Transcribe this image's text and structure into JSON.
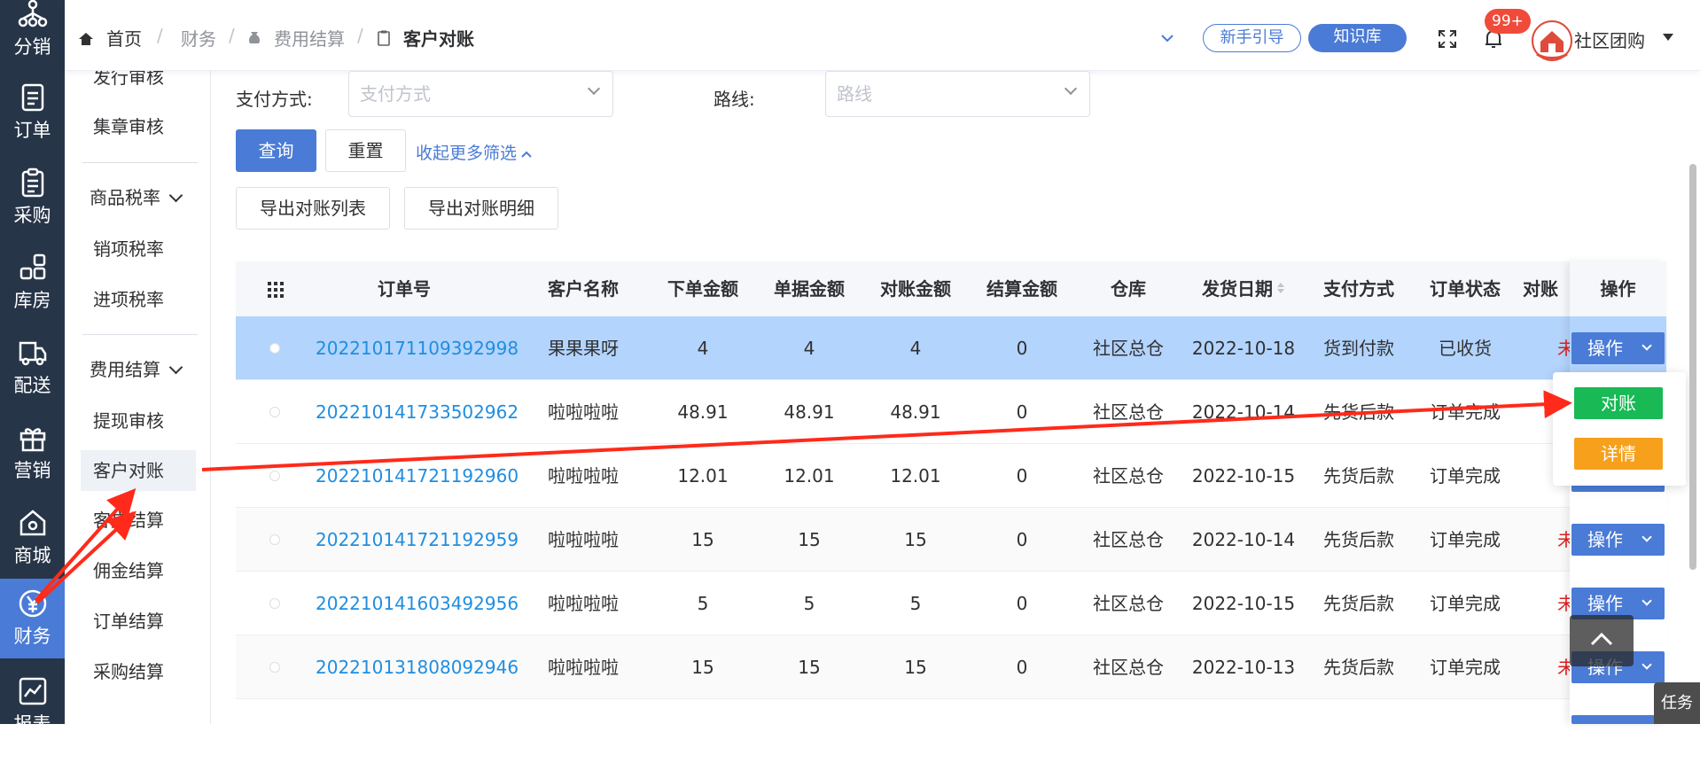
{
  "rail": {
    "items": [
      {
        "label": "分销",
        "icon": "sitemap-icon"
      },
      {
        "label": "订单",
        "icon": "document-icon"
      },
      {
        "label": "采购",
        "icon": "clipboard-icon"
      },
      {
        "label": "库房",
        "icon": "grid-icon"
      },
      {
        "label": "配送",
        "icon": "truck-icon"
      },
      {
        "label": "营销",
        "icon": "gift-icon"
      },
      {
        "label": "商城",
        "icon": "store-icon"
      },
      {
        "label": "财务",
        "icon": "yen-icon"
      },
      {
        "label": "报表",
        "icon": "chart-icon"
      }
    ]
  },
  "subnav": {
    "items": [
      "发行审核",
      "集章审核",
      "商品税率",
      "销项税率",
      "进项税率",
      "费用结算",
      "提现审核",
      "客户对账",
      "客户结算",
      "佣金结算",
      "订单结算",
      "采购结算"
    ]
  },
  "header": {
    "home": "首页",
    "crumb1": "财务",
    "crumb2": "费用结算",
    "crumb3": "客户对账",
    "guide": "新手引导",
    "kb": "知识库",
    "badge": "99+",
    "user": "社区团购"
  },
  "filters": {
    "pay_label": "支付方式:",
    "pay_placeholder": "支付方式",
    "route_label": "路线:",
    "route_placeholder": "路线",
    "query": "查询",
    "reset": "重置",
    "collapse": "收起更多筛选",
    "export_list": "导出对账列表",
    "export_detail": "导出对账明细"
  },
  "table": {
    "headers": [
      "订单号",
      "客户名称",
      "下单金额",
      "单据金额",
      "对账金额",
      "结算金额",
      "仓库",
      "发货日期",
      "支付方式",
      "订单状态",
      "对账",
      "操作"
    ],
    "op_label": "操作",
    "rows": [
      {
        "order": "202210171109392998",
        "customer": "果果果呀",
        "order_amt": "4",
        "doc_amt": "4",
        "rec_amt": "4",
        "settle_amt": "0",
        "wh": "社区总仓",
        "date": "2022-10-18",
        "pay": "货到付款",
        "status": "已收货",
        "rec": "未"
      },
      {
        "order": "202210141733502962",
        "customer": "啦啦啦啦",
        "order_amt": "48.91",
        "doc_amt": "48.91",
        "rec_amt": "48.91",
        "settle_amt": "0",
        "wh": "社区总仓",
        "date": "2022-10-14",
        "pay": "先货后款",
        "status": "订单完成",
        "rec": ""
      },
      {
        "order": "202210141721192960",
        "customer": "啦啦啦啦",
        "order_amt": "12.01",
        "doc_amt": "12.01",
        "rec_amt": "12.01",
        "settle_amt": "0",
        "wh": "社区总仓",
        "date": "2022-10-15",
        "pay": "先货后款",
        "status": "订单完成",
        "rec": ""
      },
      {
        "order": "202210141721192959",
        "customer": "啦啦啦啦",
        "order_amt": "15",
        "doc_amt": "15",
        "rec_amt": "15",
        "settle_amt": "0",
        "wh": "社区总仓",
        "date": "2022-10-14",
        "pay": "先货后款",
        "status": "订单完成",
        "rec": "未"
      },
      {
        "order": "202210141603492956",
        "customer": "啦啦啦啦",
        "order_amt": "5",
        "doc_amt": "5",
        "rec_amt": "5",
        "settle_amt": "0",
        "wh": "社区总仓",
        "date": "2022-10-15",
        "pay": "先货后款",
        "status": "订单完成",
        "rec": "未"
      },
      {
        "order": "202210131808092946",
        "customer": "啦啦啦啦",
        "order_amt": "15",
        "doc_amt": "15",
        "rec_amt": "15",
        "settle_amt": "0",
        "wh": "社区总仓",
        "date": "2022-10-13",
        "pay": "先货后款",
        "status": "订单完成",
        "rec": "未"
      }
    ]
  },
  "dropdown": {
    "reconcile": "对账",
    "detail": "详情"
  },
  "task": "任务",
  "colors": {
    "primary": "#4a7bd6",
    "rail_bg": "#273548",
    "selected_row": "#b3d4fc",
    "reconcile_green": "#19b955",
    "detail_orange": "#f7a01c",
    "arrow_red": "#ff2a1a"
  }
}
